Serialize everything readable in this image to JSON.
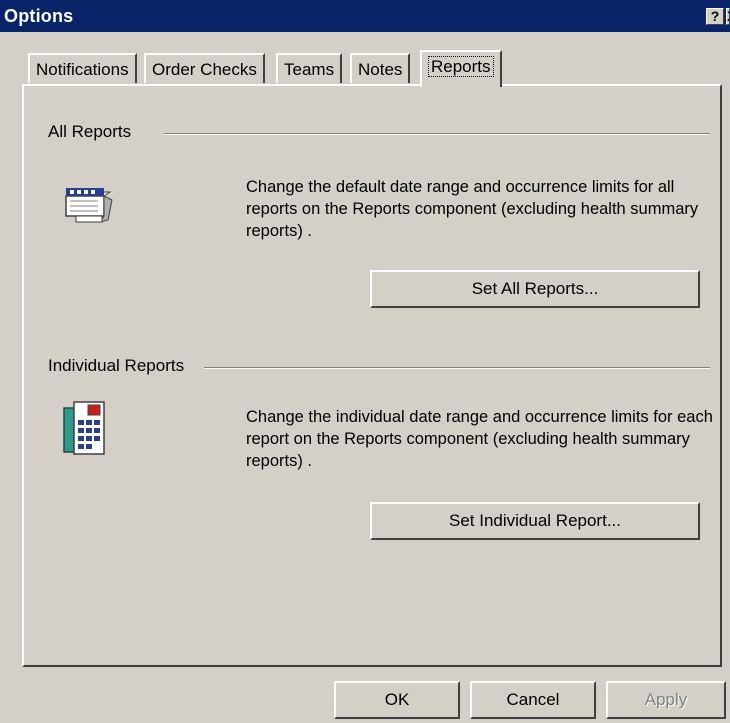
{
  "window": {
    "title": "Options",
    "help_glyph": "?",
    "close_glyph": "X"
  },
  "tabs": [
    {
      "label": "Notifications",
      "active": false
    },
    {
      "label": "Order Checks",
      "active": false
    },
    {
      "label": "Teams",
      "active": false
    },
    {
      "label": "Notes",
      "active": false
    },
    {
      "label": "Reports",
      "active": true
    }
  ],
  "all_reports": {
    "group_label": "All Reports",
    "icon": "report-date-icon",
    "description": "Change the default date range and occurrence limits for all reports on the Reports component (excluding health summary reports) .",
    "button_label": "Set All Reports..."
  },
  "individual_reports": {
    "group_label": "Individual Reports",
    "icon": "report-list-icon",
    "description": "Change the individual date range and occurrence limits for each report on the Reports component (excluding health summary reports) .",
    "button_label": "Set Individual Report..."
  },
  "footer": {
    "ok_label": "OK",
    "cancel_label": "Cancel",
    "apply_label": "Apply",
    "apply_enabled": false
  },
  "colors": {
    "titlebar": "#0a246a",
    "face": "#d4d0c8"
  }
}
